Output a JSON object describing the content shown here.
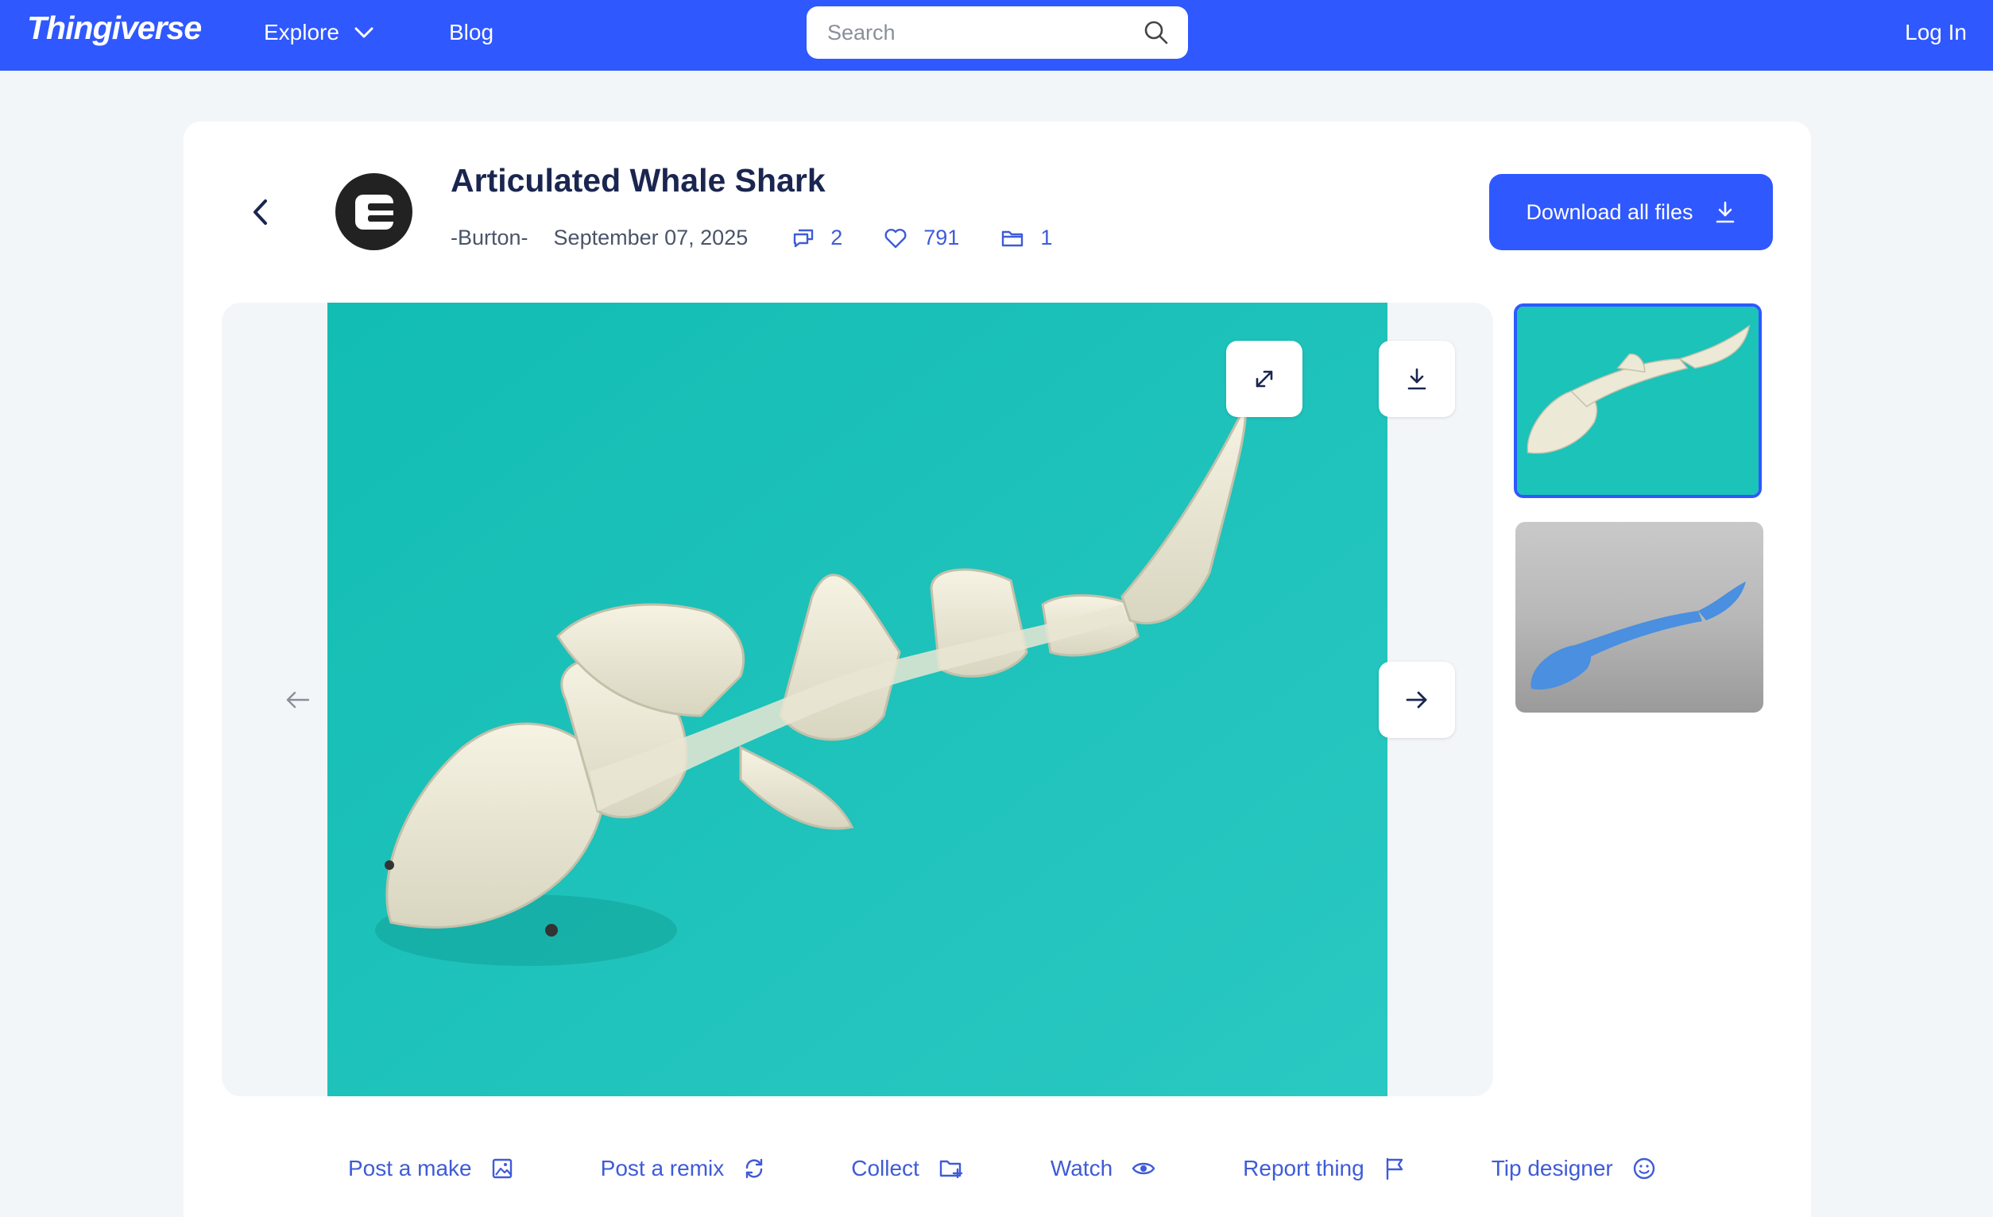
{
  "nav": {
    "logo": "Thingiverse",
    "explore_label": "Explore",
    "blog_label": "Blog",
    "search_placeholder": "Search",
    "login_label": "Log In"
  },
  "thing": {
    "title": "Articulated Whale Shark",
    "author": "-Burton-",
    "date": "September 07, 2025",
    "comments_count": "2",
    "likes_count": "791",
    "collections_count": "1",
    "download_all_label": "Download all files"
  },
  "actions": [
    {
      "label": "Post a make",
      "icon": "image-icon"
    },
    {
      "label": "Post a remix",
      "icon": "refresh-icon"
    },
    {
      "label": "Collect",
      "icon": "folder-plus-icon"
    },
    {
      "label": "Watch",
      "icon": "eye-icon"
    },
    {
      "label": "Report thing",
      "icon": "flag-icon"
    },
    {
      "label": "Tip designer",
      "icon": "smile-icon"
    }
  ],
  "colors": {
    "brand": "#2f58ff",
    "link": "#3f5bd8",
    "title": "#1a2650",
    "image_background": "#1bc3b9"
  }
}
